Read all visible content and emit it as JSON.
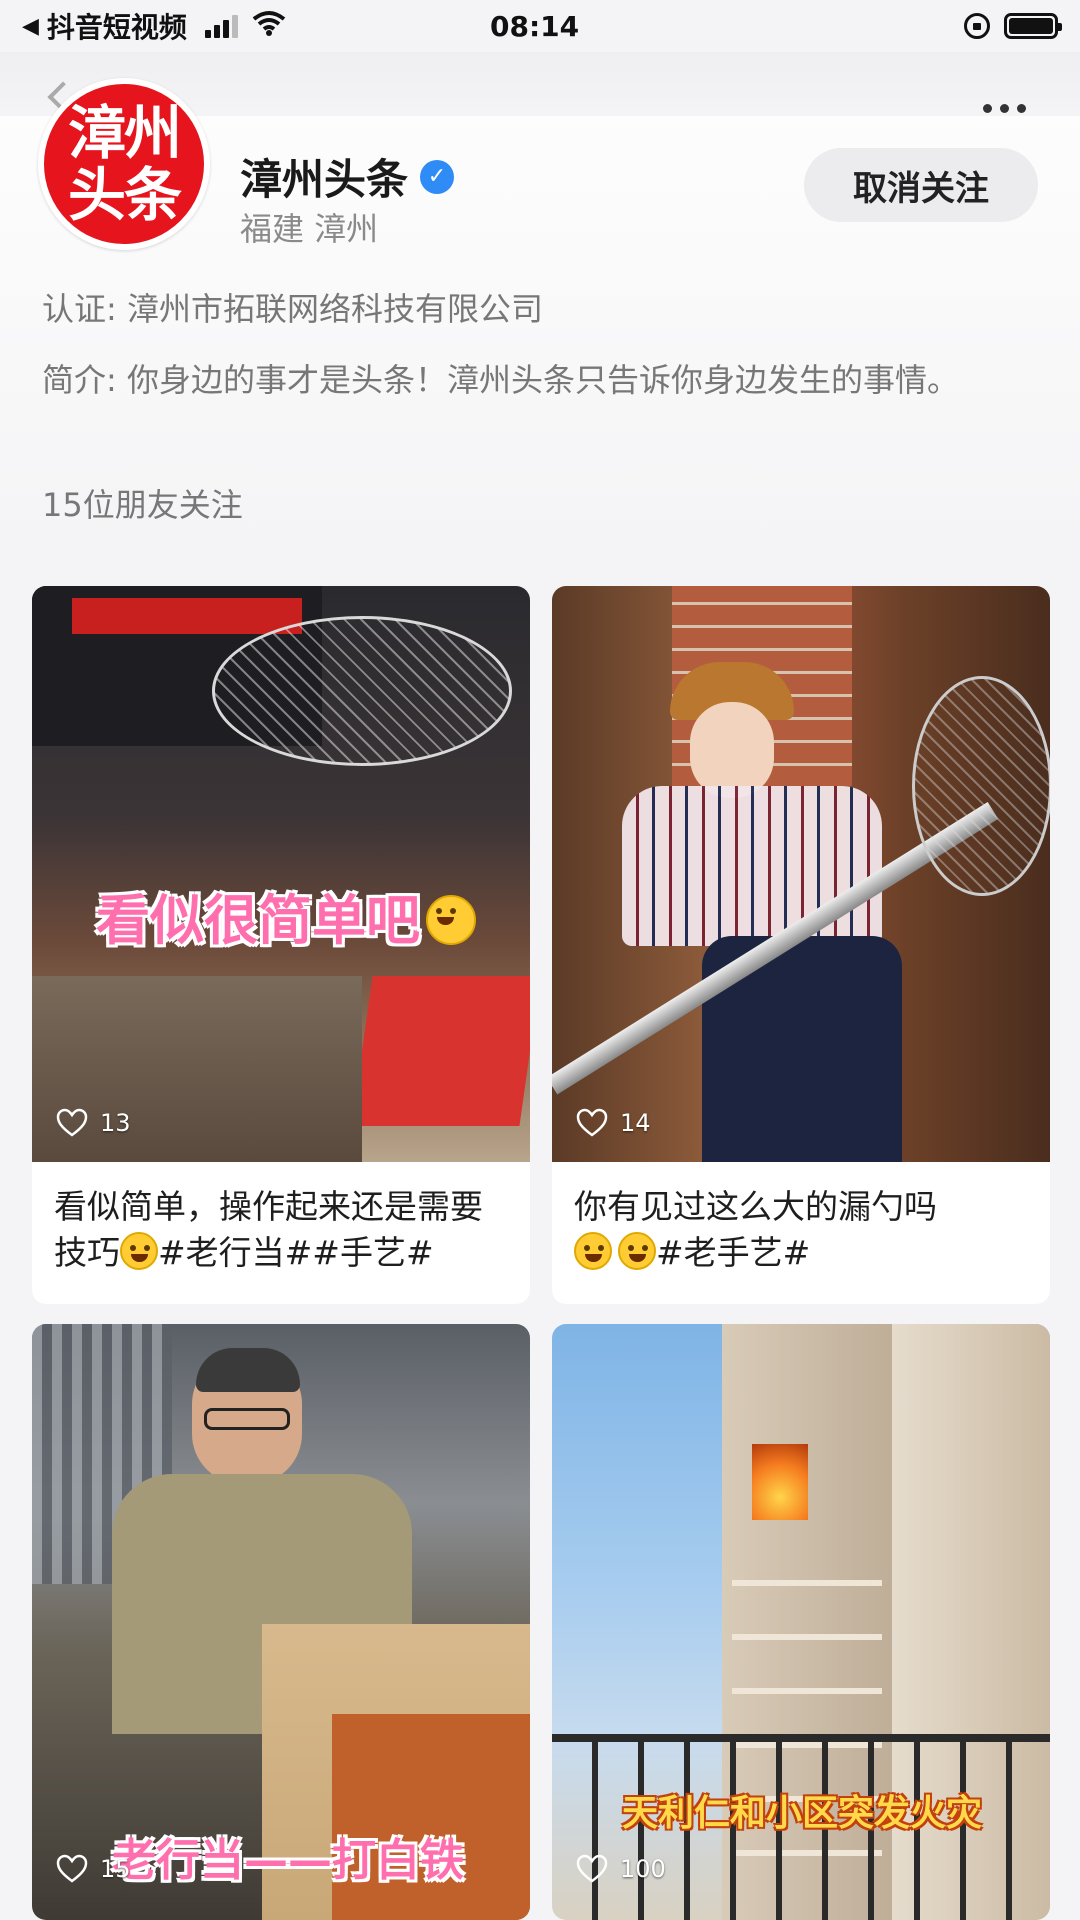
{
  "status_bar": {
    "app_back": "抖音短视频",
    "time": "08:14"
  },
  "profile": {
    "avatar_line1": "漳州",
    "avatar_line2": "头条",
    "name": "漳州头条",
    "verified_glyph": "✓",
    "location": "福建 漳州",
    "unfollow_label": "取消关注",
    "certification": "认证: 漳州市拓联网络科技有限公司",
    "intro": "简介: 你身边的事才是头条！漳州头条只告诉你身边发生的事情。",
    "friends_following": "15位朋友关注"
  },
  "videos": [
    {
      "likes": "13",
      "overlay": "看似很简单吧",
      "caption_a": "看似简单，操作起来还是需要技巧",
      "caption_b": "#老行当##手艺#"
    },
    {
      "likes": "14",
      "caption_a": "你有见过这么大的漏勺吗",
      "caption_b": "#老手艺#"
    },
    {
      "likes": "15",
      "overlay": "老行当——打白铁"
    },
    {
      "likes": "100",
      "overlay": "天利仁和小区突发火灾"
    }
  ],
  "colors": {
    "accent_red": "#e5141d",
    "verified_blue": "#2f8bf5"
  }
}
